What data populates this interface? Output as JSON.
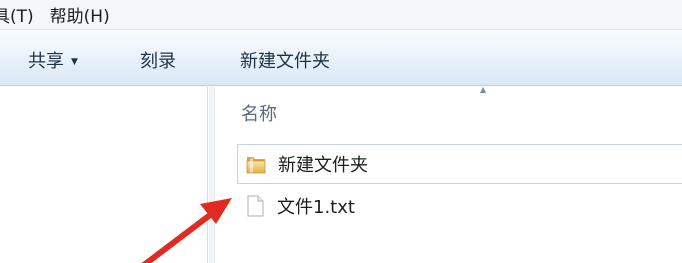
{
  "menubar": {
    "items": [
      {
        "label": "具(T)"
      },
      {
        "label": "帮助(H)"
      }
    ]
  },
  "toolbar": {
    "share_label": "共享",
    "share_caret": "▼",
    "burn_label": "刻录",
    "new_folder_label": "新建文件夹"
  },
  "content": {
    "column_header": "名称",
    "sort_indicator": "▲",
    "items": [
      {
        "name": "新建文件夹",
        "icon": "folder-icon",
        "selected": true
      },
      {
        "name": "文件1.txt",
        "icon": "text-file-icon",
        "selected": false
      }
    ]
  },
  "colors": {
    "toolbar_gradient_top": "#f7fbff",
    "toolbar_gradient_bottom": "#dbe8f5",
    "selection_border": "#c4d3e6",
    "arrow_red": "#e02a22"
  }
}
